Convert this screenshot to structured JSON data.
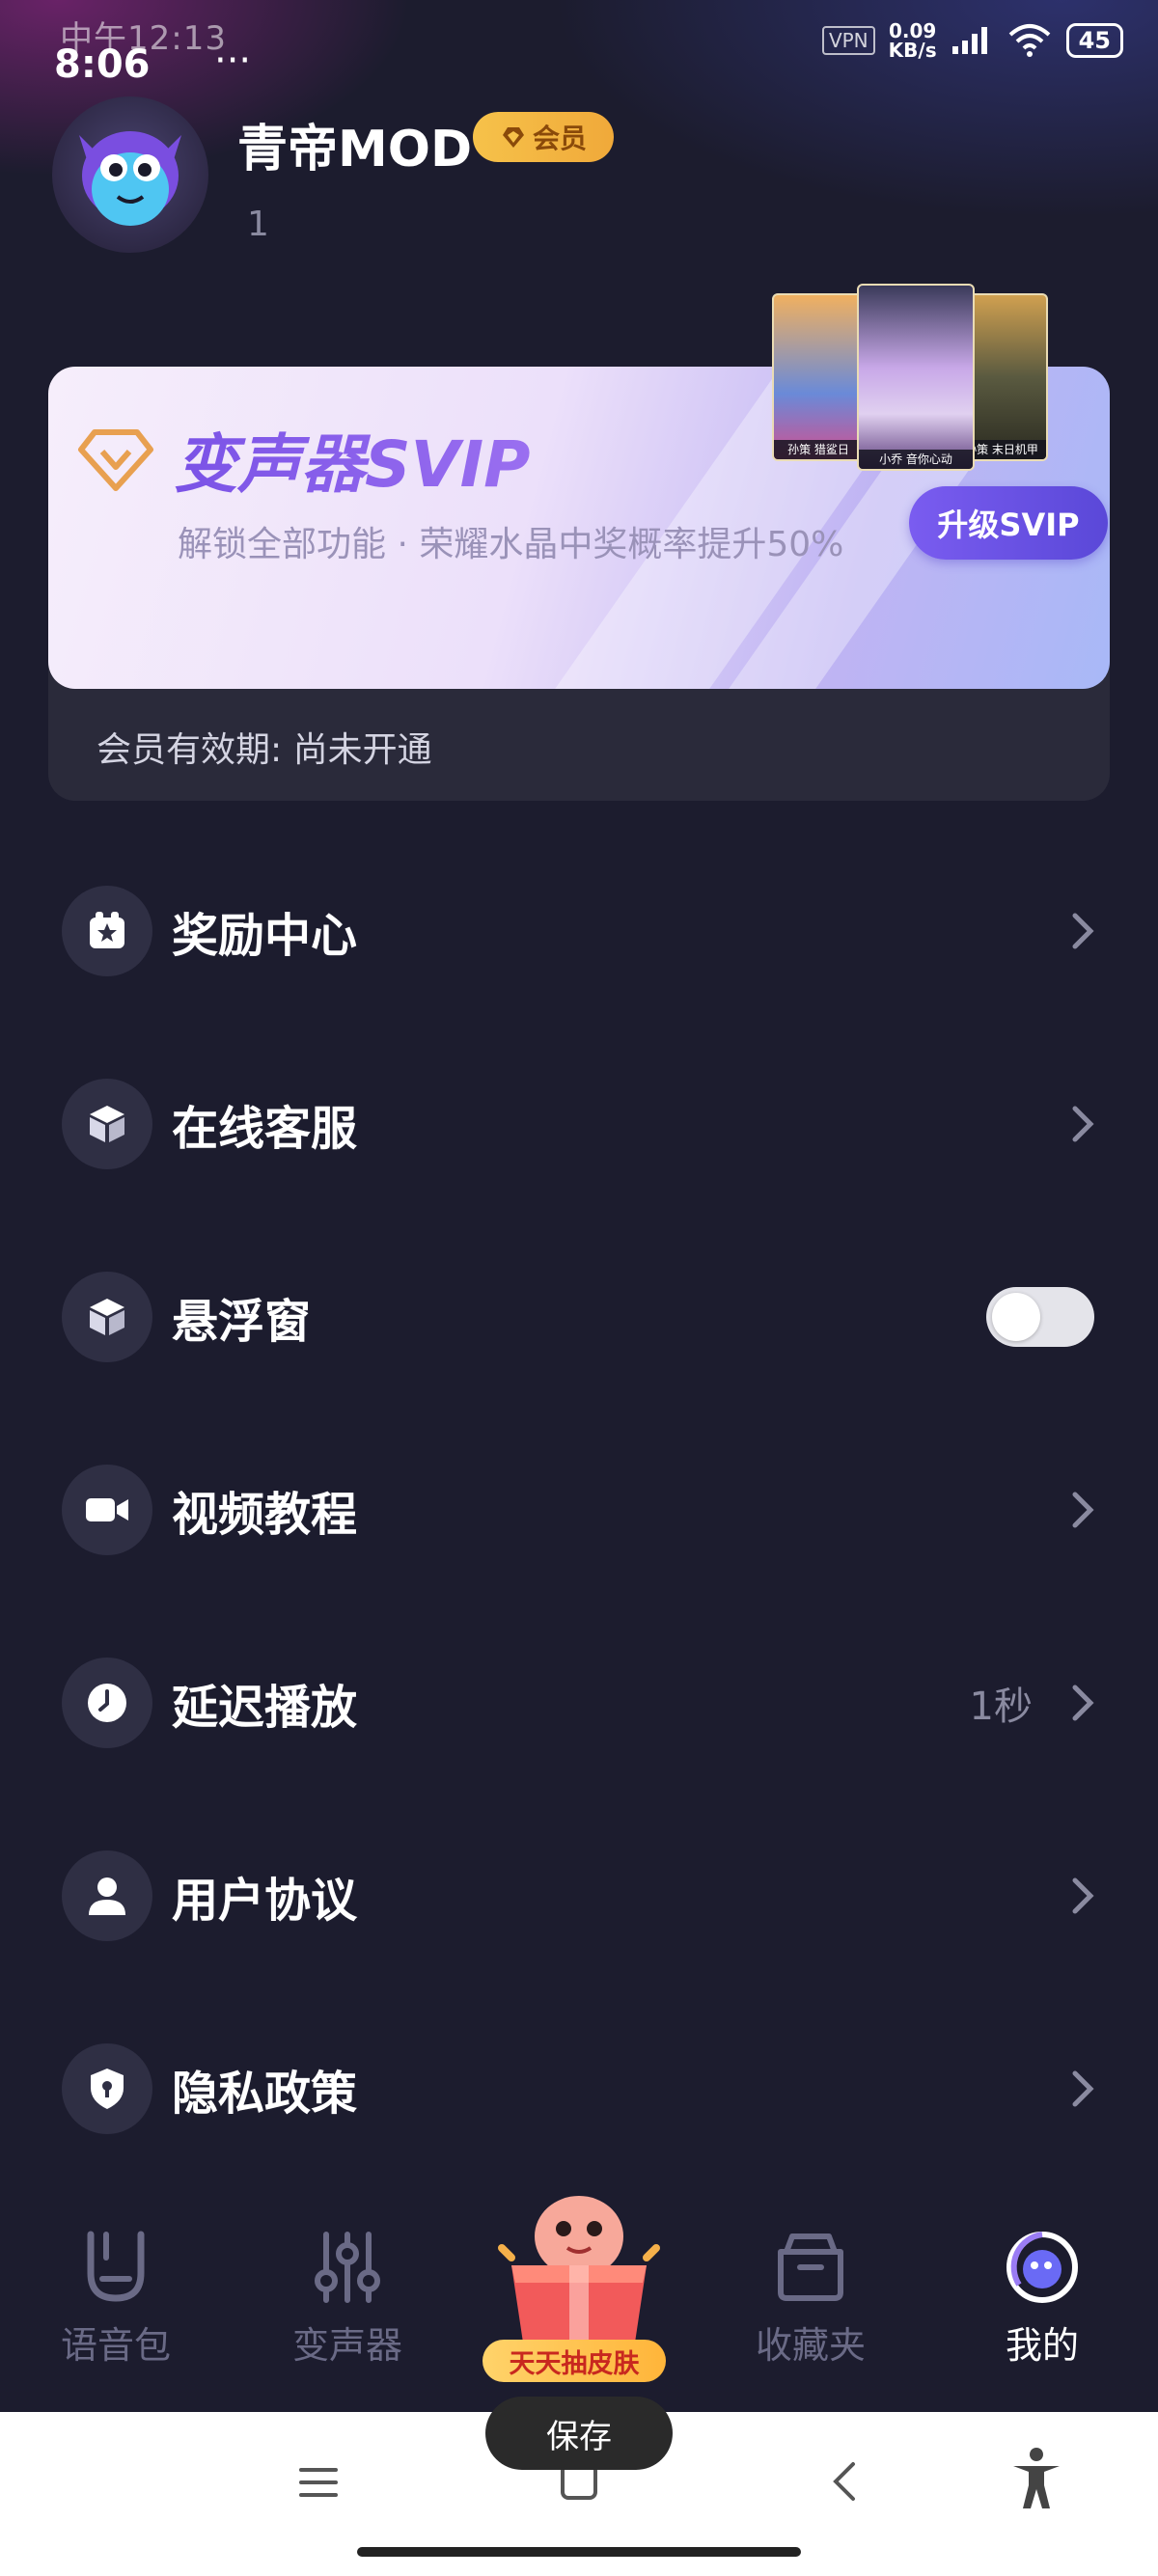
{
  "status_bar": {
    "ghost_text": "中午12:13",
    "time": "8:06",
    "dots": "···",
    "speed_value": "0.09",
    "speed_unit": "KB/s",
    "vpn": "VPN",
    "battery": "45"
  },
  "profile": {
    "username": "青帝MOD",
    "badge_label": "会员",
    "sub_text": "1"
  },
  "svip": {
    "title": "变声器SVIP",
    "description": "解锁全部功能 · 荣耀水晶中奖概率提升50%",
    "upgrade_button": "升级SVIP",
    "expiry": "会员有效期: 尚未开通",
    "heroes": [
      {
        "caption": "孙策 猎鲨日"
      },
      {
        "caption": "小乔 音你心动"
      },
      {
        "caption": "孙策 末日机甲"
      }
    ]
  },
  "menu": {
    "items": [
      {
        "label": "奖励中心",
        "icon": "gift-star-icon",
        "control": "chevron"
      },
      {
        "label": "在线客服",
        "icon": "cube-icon",
        "control": "chevron"
      },
      {
        "label": "悬浮窗",
        "icon": "cube-icon",
        "control": "toggle",
        "toggle_on": false
      },
      {
        "label": "视频教程",
        "icon": "video-camera-icon",
        "control": "chevron"
      },
      {
        "label": "延迟播放",
        "icon": "clock-icon",
        "control": "chevron",
        "value": "1秒"
      },
      {
        "label": "用户协议",
        "icon": "user-icon",
        "control": "chevron"
      },
      {
        "label": "隐私政策",
        "icon": "shield-lock-icon",
        "control": "chevron"
      }
    ]
  },
  "tabs": {
    "items": [
      {
        "label": "语音包",
        "icon": "voice-pack-icon",
        "active": false
      },
      {
        "label": "变声器",
        "icon": "sliders-icon",
        "active": false
      },
      {
        "label": "天天抽皮肤",
        "icon": "lucky-draw-icon",
        "active": false
      },
      {
        "label": "收藏夹",
        "icon": "folder-icon",
        "active": false
      },
      {
        "label": "我的",
        "icon": "profile-ring-icon",
        "active": true
      }
    ]
  },
  "toast": "保存",
  "colors": {
    "background": "#1c1c2e",
    "accent": "#6a52e6",
    "vip_gold": "#f6c24a"
  }
}
